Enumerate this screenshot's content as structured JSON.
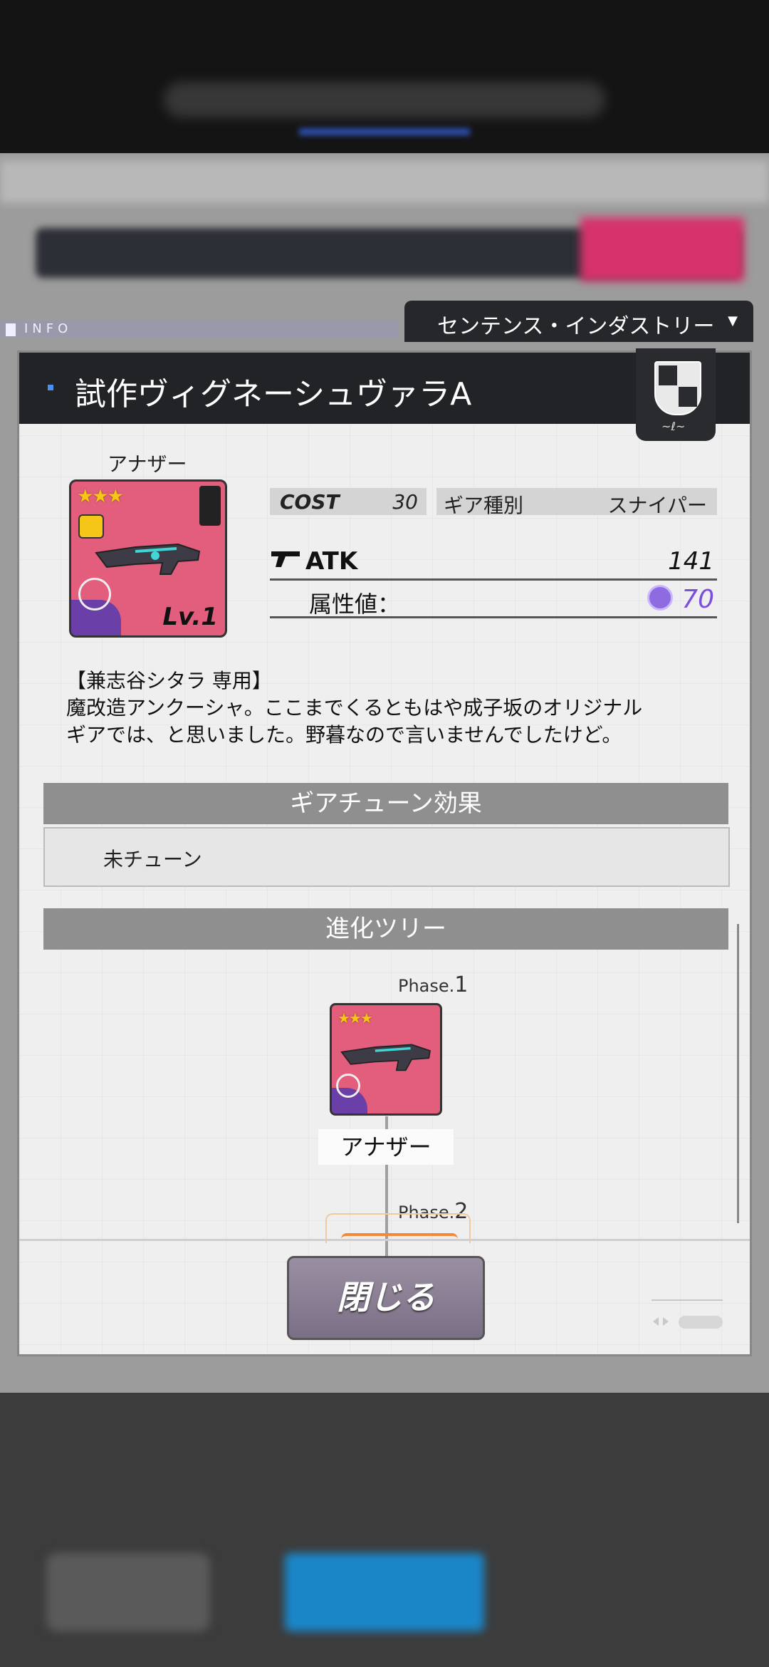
{
  "info_label": "INFO",
  "manufacturer": {
    "label": "センテンス・インダストリー",
    "caret": "▼"
  },
  "dialog": {
    "title": "試作ヴィグネーシュヴァラA",
    "rarity_label": "アナザー",
    "card": {
      "stars": "★★★",
      "level": "Lv.1"
    },
    "stats": {
      "cost_label": "COST",
      "cost_value": "30",
      "type_label": "ギア種別",
      "type_value": "スナイパー",
      "atk_label": "ATK",
      "atk_value": "141",
      "attr_label": "属性値：",
      "attr_value": "70"
    },
    "description": [
      "【兼志谷シタラ 専用】",
      "魔改造アンクーシャ。ここまでくるともはや成子坂のオリジナル",
      "ギアでは、と思いました。野暮なので言いませんでしたけど。"
    ],
    "tune_section": {
      "title": "ギアチューン効果",
      "value": "未チューン"
    },
    "tree_section": {
      "title": "進化ツリー",
      "phases": [
        {
          "phase_label": "Phase.",
          "phase_no": "1",
          "name": "アナザー",
          "stars": "★★★"
        },
        {
          "phase_label": "Phase.",
          "phase_no": "2"
        }
      ]
    },
    "close_button": "閉じる"
  },
  "colors": {
    "card_pink": "#e35d7d",
    "attr_purple": "#7a4fe0",
    "header": "#222326",
    "button": "#8a7f94"
  }
}
